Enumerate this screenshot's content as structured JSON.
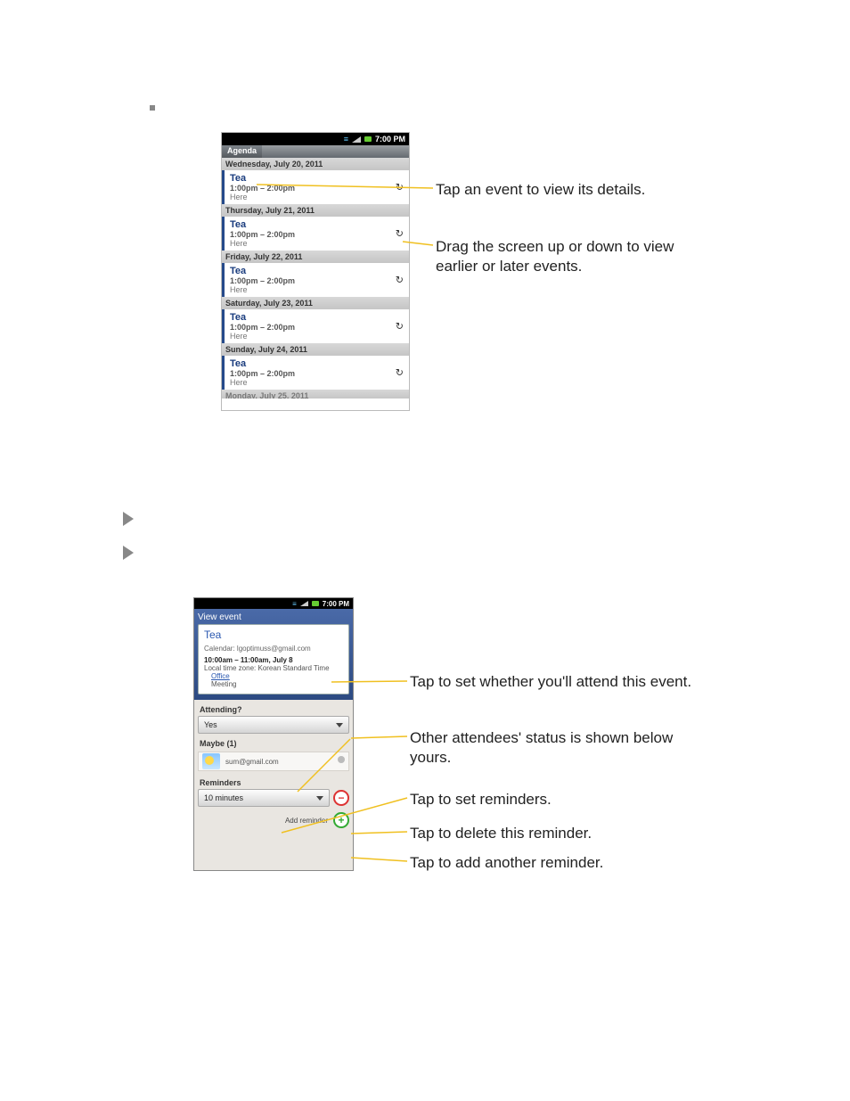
{
  "statusbar_time": "7:00 PM",
  "phone1": {
    "tab_active": "Agenda",
    "days": [
      {
        "header": "Wednesday, July 20, 2011",
        "title": "Tea",
        "time": "1:00pm – 2:00pm",
        "loc": "Here"
      },
      {
        "header": "Thursday, July 21, 2011",
        "title": "Tea",
        "time": "1:00pm – 2:00pm",
        "loc": "Here"
      },
      {
        "header": "Friday, July 22, 2011",
        "title": "Tea",
        "time": "1:00pm – 2:00pm",
        "loc": "Here"
      },
      {
        "header": "Saturday, July 23, 2011",
        "title": "Tea",
        "time": "1:00pm – 2:00pm",
        "loc": "Here"
      },
      {
        "header": "Sunday, July 24, 2011",
        "title": "Tea",
        "time": "1:00pm – 2:00pm",
        "loc": "Here"
      }
    ],
    "partial_header": "Monday, July 25, 2011"
  },
  "callouts1": {
    "a": "Tap an event to view its details.",
    "b": "Drag the screen up or down to view earlier or later events."
  },
  "phone2": {
    "titlebar": "View event",
    "event_name": "Tea",
    "calendar": "Calendar: lgoptimuss@gmail.com",
    "time": "10:00am – 11:00am, July 8",
    "tz": "Local time zone: Korean Standard Time",
    "loc_link": "Office",
    "meeting": "Meeting",
    "attending_label": "Attending?",
    "attending_value": "Yes",
    "maybe_label": "Maybe (1)",
    "attendee_email": "sum@gmail.com",
    "reminders_label": "Reminders",
    "reminder_value": "10 minutes",
    "add_reminder": "Add reminder"
  },
  "callouts2": {
    "a": "Tap to set whether you'll attend this event.",
    "b": "Other attendees' status is shown below yours.",
    "c": "Tap to set reminders.",
    "d": "Tap to delete this reminder.",
    "e": "Tap to add another reminder."
  }
}
